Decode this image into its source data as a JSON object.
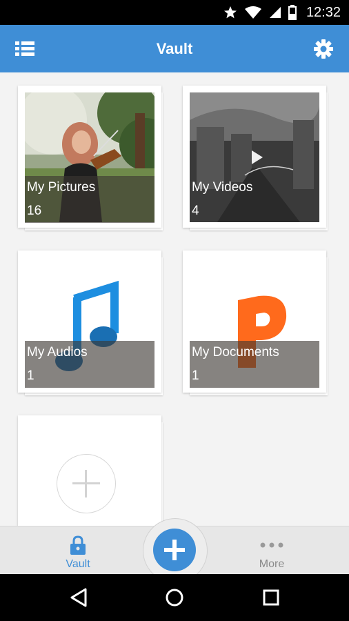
{
  "status_bar": {
    "time": "12:32",
    "icons": [
      "star-icon",
      "wifi-icon",
      "cellular-signal-icon",
      "battery-icon"
    ]
  },
  "app_bar": {
    "title": "Vault",
    "left_icon": "list-menu-icon",
    "right_icon": "gear-icon",
    "color": "#3f8ed6"
  },
  "folders": [
    {
      "name": "My Pictures",
      "count": "16",
      "thumb": "violinist-photo"
    },
    {
      "name": "My Videos",
      "count": "4",
      "thumb": "video-still-with-play-icon"
    },
    {
      "name": "My Audios",
      "count": "1",
      "thumb": "music-note-icon"
    },
    {
      "name": "My Documents",
      "count": "1",
      "thumb": "document-p-icon"
    }
  ],
  "add_folder_icon": "plus-circle-icon",
  "bottom_bar": {
    "tabs": [
      {
        "label": "Vault",
        "icon": "lock-icon",
        "active": true
      },
      {
        "label": "More",
        "icon": "more-dots-icon",
        "active": false
      }
    ],
    "fab_icon": "plus-icon"
  },
  "nav_bar": {
    "icons": [
      "back-triangle-icon",
      "home-circle-icon",
      "recents-square-icon"
    ]
  }
}
